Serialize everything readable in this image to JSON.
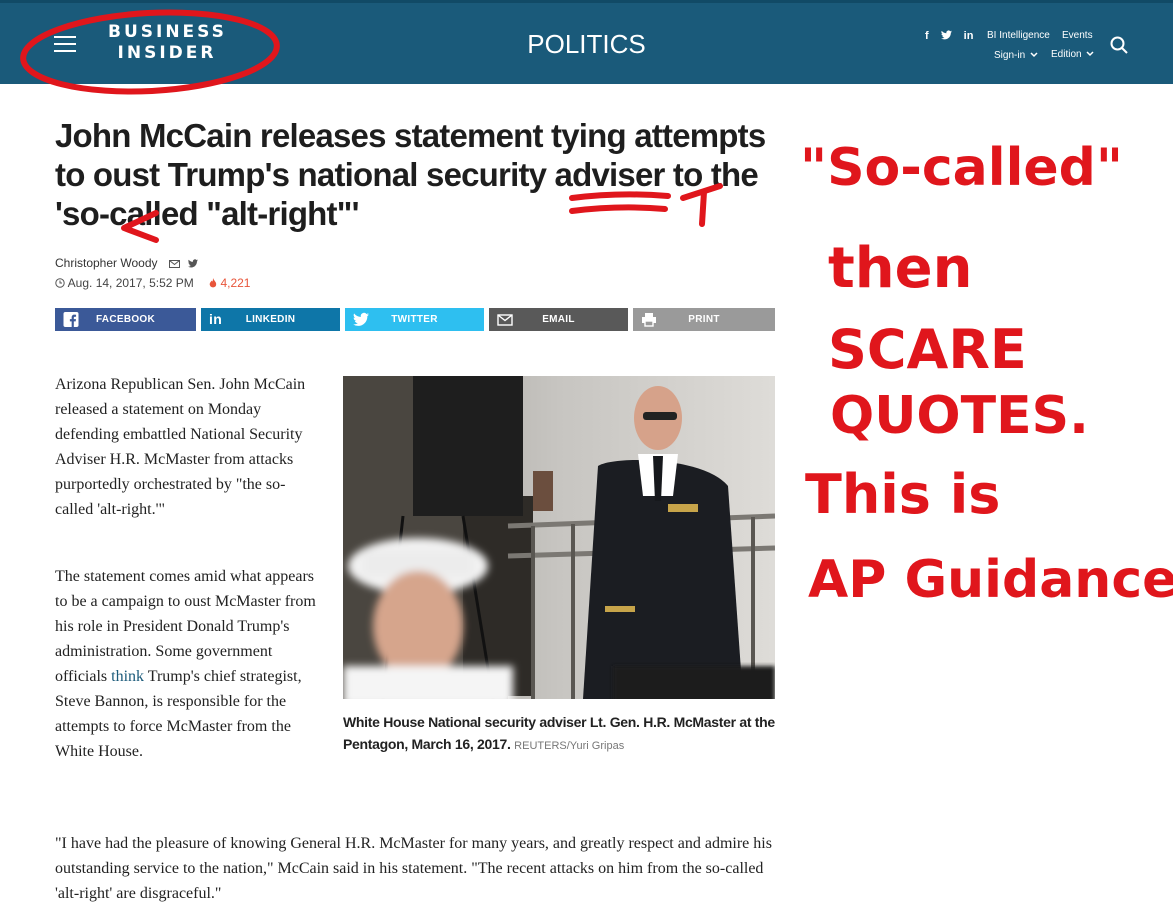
{
  "header": {
    "logo_line1": "BUSINESS",
    "logo_line2": "INSIDER",
    "section": "POLITICS",
    "social": [
      "f",
      "t",
      "in"
    ],
    "bi_intelligence": "BI Intelligence",
    "events": "Events",
    "sign_in": "Sign-in",
    "edition": "Edition",
    "icons": [
      "hamburger-icon",
      "facebook-icon",
      "twitter-icon",
      "linkedin-icon",
      "chevron-down-icon",
      "search-icon"
    ]
  },
  "article": {
    "headline": "John McCain releases statement tying attempts to oust Trump's national security adviser to the 'so-called \"alt-right\"'",
    "author": "Christopher Woody",
    "date": "Aug. 14, 2017, 5:52 PM",
    "views": "4,221",
    "share": {
      "facebook": "FACEBOOK",
      "linkedin": "LINKEDIN",
      "twitter": "TWITTER",
      "email": "EMAIL",
      "print": "PRINT"
    },
    "para1": "Arizona Republican Sen. John McCain released a statement on Monday defending embattled National Security Adviser H.R. McMaster from attacks purportedly orchestrated by \"the so-called 'alt-right.'\"",
    "para2_a": "The statement comes amid what appears to be a campaign to oust McMaster from his role in President Donald Trump's administration. Some government officials ",
    "para2_link": "think",
    "para2_b": " Trump's chief strategist, Steve Bannon, is responsible for the attempts to force McMaster from the White House.",
    "para3": "\"I have had the pleasure of knowing General H.R. McMaster for many years, and greatly respect and admire his outstanding service to the nation,\" McCain said in his statement. \"The recent attacks on him from the so-called 'alt-right' are disgraceful.\"",
    "caption": "White House National security adviser Lt. Gen. H.R. McMaster at the Pentagon, March 16, 2017.",
    "credit": "REUTERS/Yuri Gripas"
  },
  "annotation": {
    "line1": "\"So-called\"",
    "line2": "then",
    "line3": "SCARE",
    "line4": "QUOTES.",
    "line5": "This is",
    "line6": "AP Guidance.",
    "color": "#e0161c"
  },
  "colors": {
    "header": "#1a5a7a",
    "facebook": "#3b5998",
    "linkedin": "#0e76a8",
    "twitter": "#2ebff0",
    "email": "#595959",
    "print": "#9a9a9a",
    "views": "#e8553a"
  }
}
